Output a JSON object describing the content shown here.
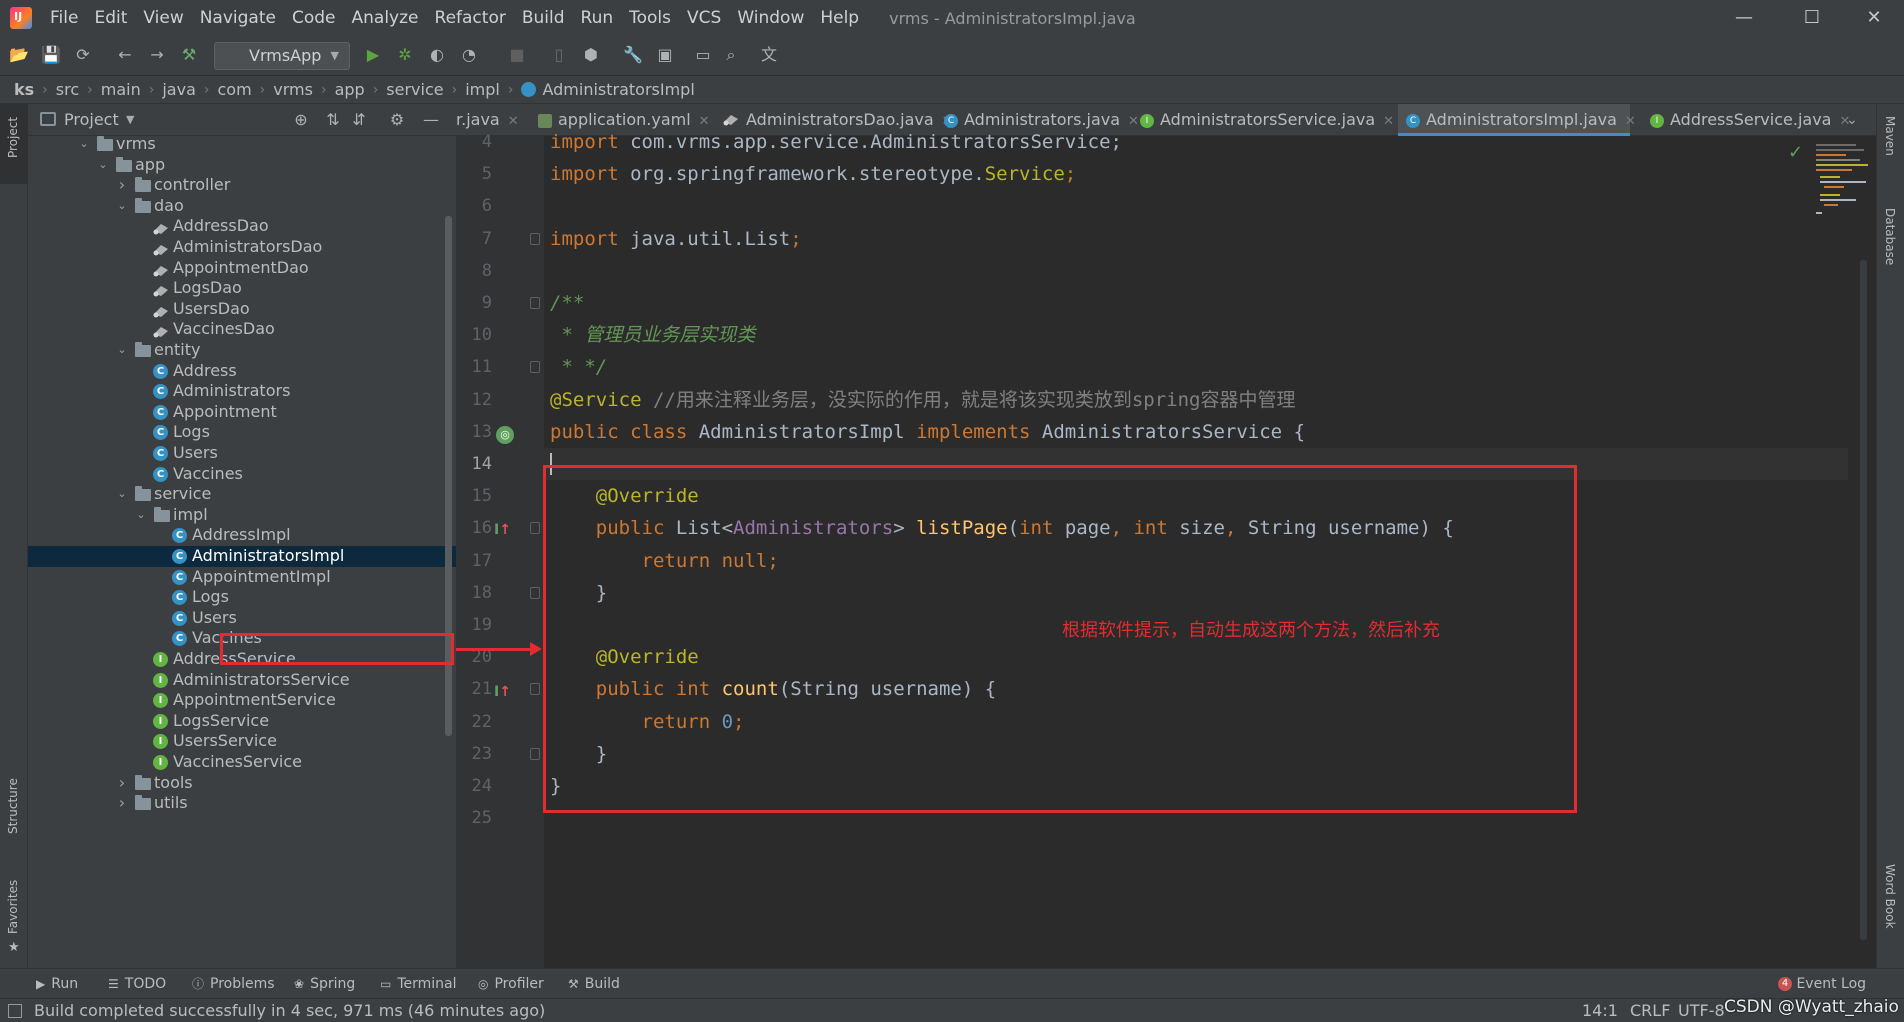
{
  "menu": {
    "items": [
      "File",
      "Edit",
      "View",
      "Navigate",
      "Code",
      "Analyze",
      "Refactor",
      "Build",
      "Run",
      "Tools",
      "VCS",
      "Window",
      "Help"
    ],
    "window_title": "vrms - AdministratorsImpl.java"
  },
  "toolbar": {
    "run_config": "VrmsApp"
  },
  "breadcrumbs": [
    "ks",
    "src",
    "main",
    "java",
    "com",
    "vrms",
    "app",
    "service",
    "impl",
    "AdministratorsImpl"
  ],
  "left_strip": {
    "project": "Project",
    "structure": "Structure",
    "favorites": "Favorites"
  },
  "right_strip": {
    "maven": "Maven",
    "database": "Database",
    "word_book": "Word Book"
  },
  "project_panel": {
    "title": "Project",
    "tree": [
      {
        "label": "vrms",
        "type": "folder",
        "depth": 0,
        "expanded": true
      },
      {
        "label": "app",
        "type": "folder",
        "depth": 1,
        "expanded": true
      },
      {
        "label": "controller",
        "type": "folder",
        "depth": 2,
        "expanded": false
      },
      {
        "label": "dao",
        "type": "folder",
        "depth": 2,
        "expanded": true
      },
      {
        "label": "AddressDao",
        "type": "dao",
        "depth": 3
      },
      {
        "label": "AdministratorsDao",
        "type": "dao",
        "depth": 3
      },
      {
        "label": "AppointmentDao",
        "type": "dao",
        "depth": 3
      },
      {
        "label": "LogsDao",
        "type": "dao",
        "depth": 3
      },
      {
        "label": "UsersDao",
        "type": "dao",
        "depth": 3
      },
      {
        "label": "VaccinesDao",
        "type": "dao",
        "depth": 3
      },
      {
        "label": "entity",
        "type": "folder",
        "depth": 2,
        "expanded": true
      },
      {
        "label": "Address",
        "type": "class",
        "depth": 3
      },
      {
        "label": "Administrators",
        "type": "class",
        "depth": 3
      },
      {
        "label": "Appointment",
        "type": "class",
        "depth": 3
      },
      {
        "label": "Logs",
        "type": "class",
        "depth": 3
      },
      {
        "label": "Users",
        "type": "class",
        "depth": 3
      },
      {
        "label": "Vaccines",
        "type": "class",
        "depth": 3
      },
      {
        "label": "service",
        "type": "folder",
        "depth": 2,
        "expanded": true
      },
      {
        "label": "impl",
        "type": "folder",
        "depth": 3,
        "expanded": true
      },
      {
        "label": "AddressImpl",
        "type": "class",
        "depth": 4
      },
      {
        "label": "AdministratorsImpl",
        "type": "class",
        "depth": 4,
        "selected": true
      },
      {
        "label": "AppointmentImpl",
        "type": "class",
        "depth": 4
      },
      {
        "label": "Logs",
        "type": "class",
        "depth": 4
      },
      {
        "label": "Users",
        "type": "class",
        "depth": 4
      },
      {
        "label": "Vaccines",
        "type": "class",
        "depth": 4
      },
      {
        "label": "AddressService",
        "type": "interface",
        "depth": 3
      },
      {
        "label": "AdministratorsService",
        "type": "interface",
        "depth": 3
      },
      {
        "label": "AppointmentService",
        "type": "interface",
        "depth": 3
      },
      {
        "label": "LogsService",
        "type": "interface",
        "depth": 3
      },
      {
        "label": "UsersService",
        "type": "interface",
        "depth": 3
      },
      {
        "label": "VaccinesService",
        "type": "interface",
        "depth": 3
      },
      {
        "label": "tools",
        "type": "folder",
        "depth": 2,
        "expanded": false
      },
      {
        "label": "utils",
        "type": "folder",
        "depth": 2,
        "expanded": false
      }
    ]
  },
  "tabs": [
    {
      "label": "r.java",
      "icon": "class",
      "active": false
    },
    {
      "label": "application.yaml",
      "icon": "yaml",
      "active": false
    },
    {
      "label": "AdministratorsDao.java",
      "icon": "dao",
      "active": false
    },
    {
      "label": "Administrators.java",
      "icon": "class",
      "active": false
    },
    {
      "label": "AdministratorsService.java",
      "icon": "interface",
      "active": false
    },
    {
      "label": "AdministratorsImpl.java",
      "icon": "class",
      "active": true
    },
    {
      "label": "AddressService.java",
      "icon": "interface",
      "active": false
    }
  ],
  "editor": {
    "current_line": 14,
    "lines": [
      {
        "n": 4,
        "tokens": [
          [
            "kw",
            "import "
          ],
          [
            "cls",
            "com.vrms.app.service.AdministratorsService;"
          ]
        ]
      },
      {
        "n": 5,
        "tokens": [
          [
            "kw",
            "import "
          ],
          [
            "cls",
            "org.springframework.stereotype."
          ],
          [
            "ann",
            "Service"
          ],
          [
            "kw",
            ";"
          ]
        ]
      },
      {
        "n": 6,
        "tokens": []
      },
      {
        "n": 7,
        "tokens": [
          [
            "kw",
            "import "
          ],
          [
            "cls",
            "java.util.List"
          ],
          [
            "kw",
            ";"
          ]
        ]
      },
      {
        "n": 8,
        "tokens": []
      },
      {
        "n": 9,
        "tokens": [
          [
            "doc",
            "/**"
          ]
        ]
      },
      {
        "n": 10,
        "tokens": [
          [
            "doc",
            " * 管理员业务层实现类"
          ]
        ]
      },
      {
        "n": 11,
        "tokens": [
          [
            "doc",
            " * */"
          ]
        ]
      },
      {
        "n": 12,
        "tokens": [
          [
            "ann",
            "@Service "
          ],
          [
            "cmt",
            "//用来注释业务层，没实际的作用，就是将该实现类放到spring容器中管理"
          ]
        ]
      },
      {
        "n": 13,
        "tokens": [
          [
            "kw",
            "public class "
          ],
          [
            "cls",
            "AdministratorsImpl "
          ],
          [
            "kw",
            "implements "
          ],
          [
            "cls",
            "AdministratorsService {"
          ]
        ]
      },
      {
        "n": 14,
        "tokens": []
      },
      {
        "n": 15,
        "tokens": [
          [
            "cls",
            "    "
          ],
          [
            "ann",
            "@Override"
          ]
        ]
      },
      {
        "n": 16,
        "tokens": [
          [
            "cls",
            "    "
          ],
          [
            "kw",
            "public "
          ],
          [
            "cls",
            "List<"
          ],
          [
            "lnk",
            "Administrators"
          ],
          [
            "cls",
            "> "
          ],
          [
            "fn",
            "listPage"
          ],
          [
            "cls",
            "("
          ],
          [
            "kw",
            "int "
          ],
          [
            "cls",
            "page"
          ],
          [
            "kw",
            ", int "
          ],
          [
            "cls",
            "size"
          ],
          [
            "kw",
            ", "
          ],
          [
            "cls",
            "String username) {"
          ]
        ]
      },
      {
        "n": 17,
        "tokens": [
          [
            "cls",
            "        "
          ],
          [
            "kw",
            "return null;"
          ]
        ]
      },
      {
        "n": 18,
        "tokens": [
          [
            "cls",
            "    }"
          ]
        ]
      },
      {
        "n": 19,
        "tokens": []
      },
      {
        "n": 20,
        "tokens": [
          [
            "cls",
            "    "
          ],
          [
            "ann",
            "@Override"
          ]
        ]
      },
      {
        "n": 21,
        "tokens": [
          [
            "cls",
            "    "
          ],
          [
            "kw",
            "public int "
          ],
          [
            "fn",
            "count"
          ],
          [
            "cls",
            "(String username) {"
          ]
        ]
      },
      {
        "n": 22,
        "tokens": [
          [
            "cls",
            "        "
          ],
          [
            "kw",
            "return "
          ],
          [
            "num",
            "0"
          ],
          [
            "kw",
            ";"
          ]
        ]
      },
      {
        "n": 23,
        "tokens": [
          [
            "cls",
            "    }"
          ]
        ]
      },
      {
        "n": 24,
        "tokens": [
          [
            "cls",
            "}"
          ]
        ]
      },
      {
        "n": 25,
        "tokens": []
      }
    ]
  },
  "annotation_note": "根据软件提示，自动生成这两个方法，然后补充",
  "bottom_tools": [
    "Run",
    "TODO",
    "Problems",
    "Spring",
    "Terminal",
    "Profiler",
    "Build"
  ],
  "event_log": {
    "label": "Event Log",
    "count": "4"
  },
  "status": {
    "message": "Build completed successfully in 4 sec, 971 ms (46 minutes ago)",
    "position": "14:1",
    "line_sep": "CRLF",
    "encoding": "UTF-8",
    "watermark": "CSDN @Wyatt_zhaio"
  },
  "colors": {
    "accent": "#4a88c7",
    "highlight": "#e22c30",
    "selection": "#0d293e"
  }
}
